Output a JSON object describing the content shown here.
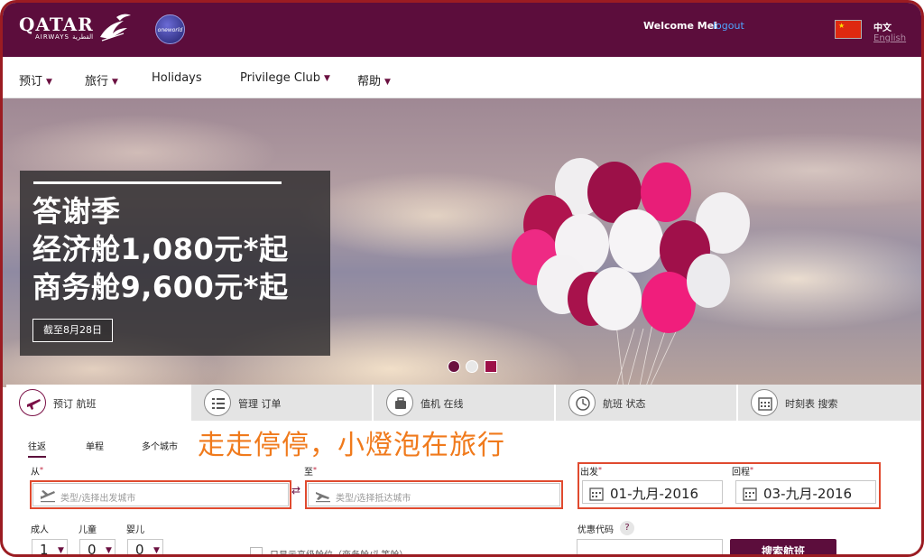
{
  "header": {
    "logo_main": "QATAR",
    "logo_sub": "AIRWAYS القطرية",
    "alliance_logo": "oneworld",
    "welcome": "Welcome Mei",
    "logout": "logout",
    "lang_current": "中文",
    "lang_alt": "English"
  },
  "nav": {
    "items": [
      {
        "label": "预订",
        "has_dropdown": true
      },
      {
        "label": "旅行",
        "has_dropdown": true
      },
      {
        "label": "Holidays",
        "has_dropdown": false
      },
      {
        "label": "Privilege Club",
        "has_dropdown": true
      },
      {
        "label": "帮助",
        "has_dropdown": true
      }
    ]
  },
  "hero": {
    "line1": "答谢季",
    "line2": "经济舱1,080元*起",
    "line3": "商务舱9,600元*起",
    "cta": "截至8月28日",
    "slides": 3,
    "active_slide": 1
  },
  "booking": {
    "tabs": [
      {
        "label": "预订 航班",
        "icon": "plane-icon",
        "active": true
      },
      {
        "label": "管理 订单",
        "icon": "list-icon",
        "active": false
      },
      {
        "label": "值机 在线",
        "icon": "suitcase-icon",
        "active": false
      },
      {
        "label": "航班 状态",
        "icon": "clock-icon",
        "active": false
      },
      {
        "label": "时刻表 搜索",
        "icon": "calendar-icon",
        "active": false
      }
    ],
    "trip_types": [
      "往返",
      "单程",
      "多个城市"
    ],
    "watermark": "走走停停，小燈泡在旅行",
    "from_label": "从",
    "from_placeholder": "类型/选择出发城市",
    "to_label": "至",
    "to_placeholder": "类型/选择抵达城市",
    "depart_label": "出发",
    "depart_value": "01-九月-2016",
    "return_label": "回程",
    "return_value": "03-九月-2016",
    "adults_label": "成人",
    "adults_value": "1",
    "children_label": "儿童",
    "children_value": "0",
    "infants_label": "婴儿",
    "infants_value": "0",
    "premium_label": "只显示高级舱位（商务舱/头等舱）",
    "promo_label": "优惠代码",
    "help": "?",
    "search_label": "搜索航班"
  },
  "colors": {
    "brand": "#5c0d3c",
    "link": "#4fa6ff",
    "annotation": "#e04a2f",
    "watermark": "#f07a1c"
  }
}
